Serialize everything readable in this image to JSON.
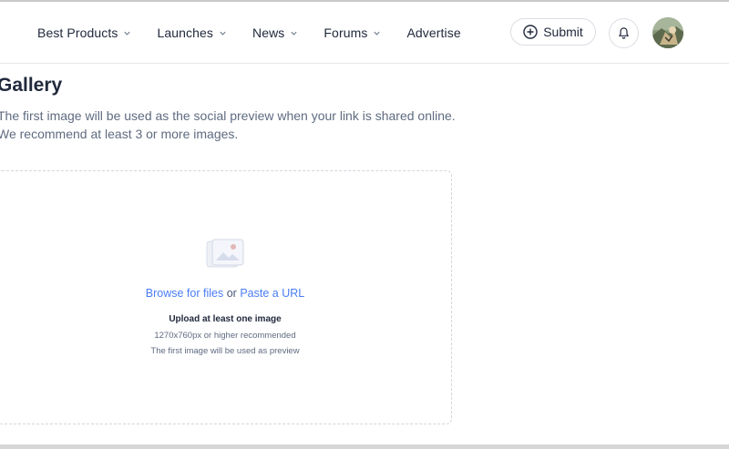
{
  "nav": {
    "items": [
      {
        "label": "Best Products",
        "has_chevron": true
      },
      {
        "label": "Launches",
        "has_chevron": true
      },
      {
        "label": "News",
        "has_chevron": true
      },
      {
        "label": "Forums",
        "has_chevron": true
      },
      {
        "label": "Advertise",
        "has_chevron": false
      }
    ],
    "submit_label": "Submit",
    "icons": [
      "plus-circle-icon",
      "bell-icon",
      "avatar"
    ]
  },
  "gallery": {
    "title": "Gallery",
    "description_line1": "The first image will be used as the social preview when your link is shared online.",
    "description_line2": "We recommend at least 3 or more images.",
    "dropzone": {
      "browse_label": "Browse for files",
      "or_label": "or",
      "paste_label": "Paste a URL",
      "heading": "Upload at least one image",
      "size_hint": "1270x760px or higher recommended",
      "preview_hint": "The first image will be used as preview"
    }
  },
  "colors": {
    "link": "#4a7cf6",
    "text_primary": "#21293c",
    "text_secondary": "#5f6b80",
    "border": "#dadde3"
  }
}
